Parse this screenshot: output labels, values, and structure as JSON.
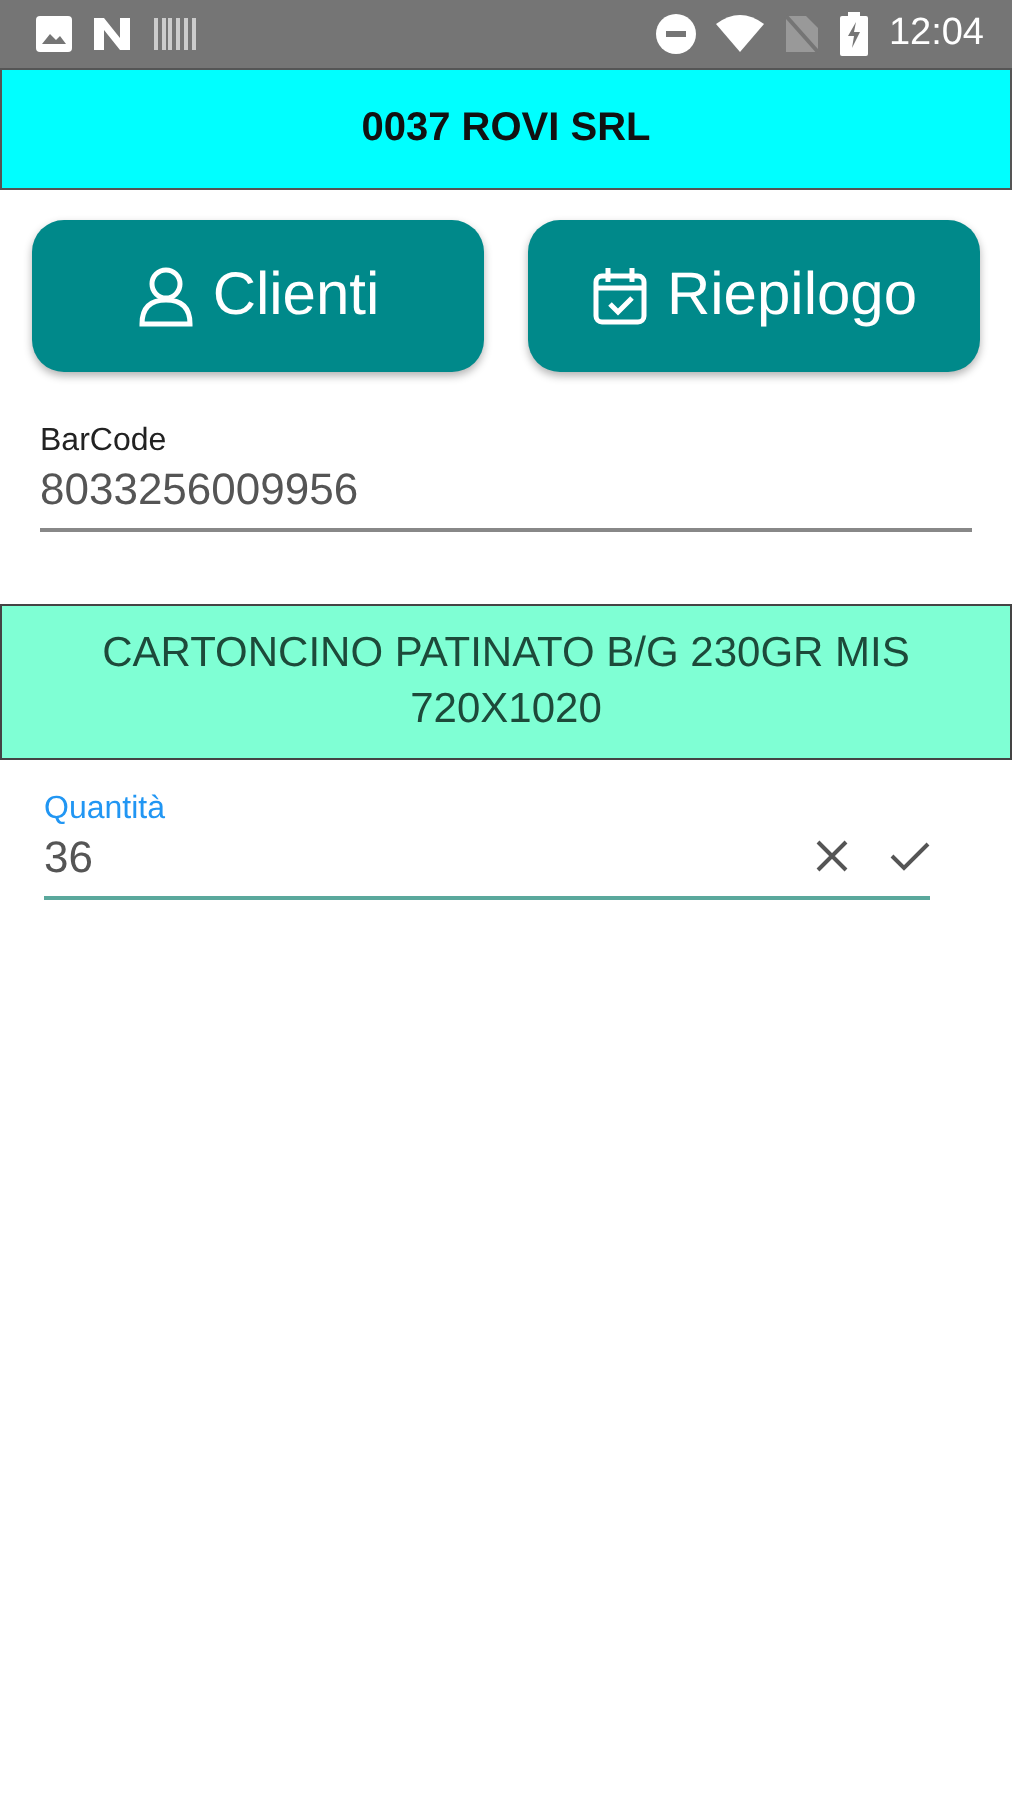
{
  "status_bar": {
    "time": "12:04"
  },
  "header": {
    "title": "0037 ROVI SRL"
  },
  "buttons": [
    {
      "kind": "person",
      "label": "Clienti"
    },
    {
      "kind": "calendar",
      "label": "Riepilogo"
    }
  ],
  "barcode": {
    "label": "BarCode",
    "value": "8033256009956",
    "focused": false
  },
  "description": {
    "text": "CARTONCINO PATINATO B/G 230GR MIS 720X1020"
  },
  "quantity": {
    "label": "Quantità",
    "value": "36",
    "focused": true
  }
}
